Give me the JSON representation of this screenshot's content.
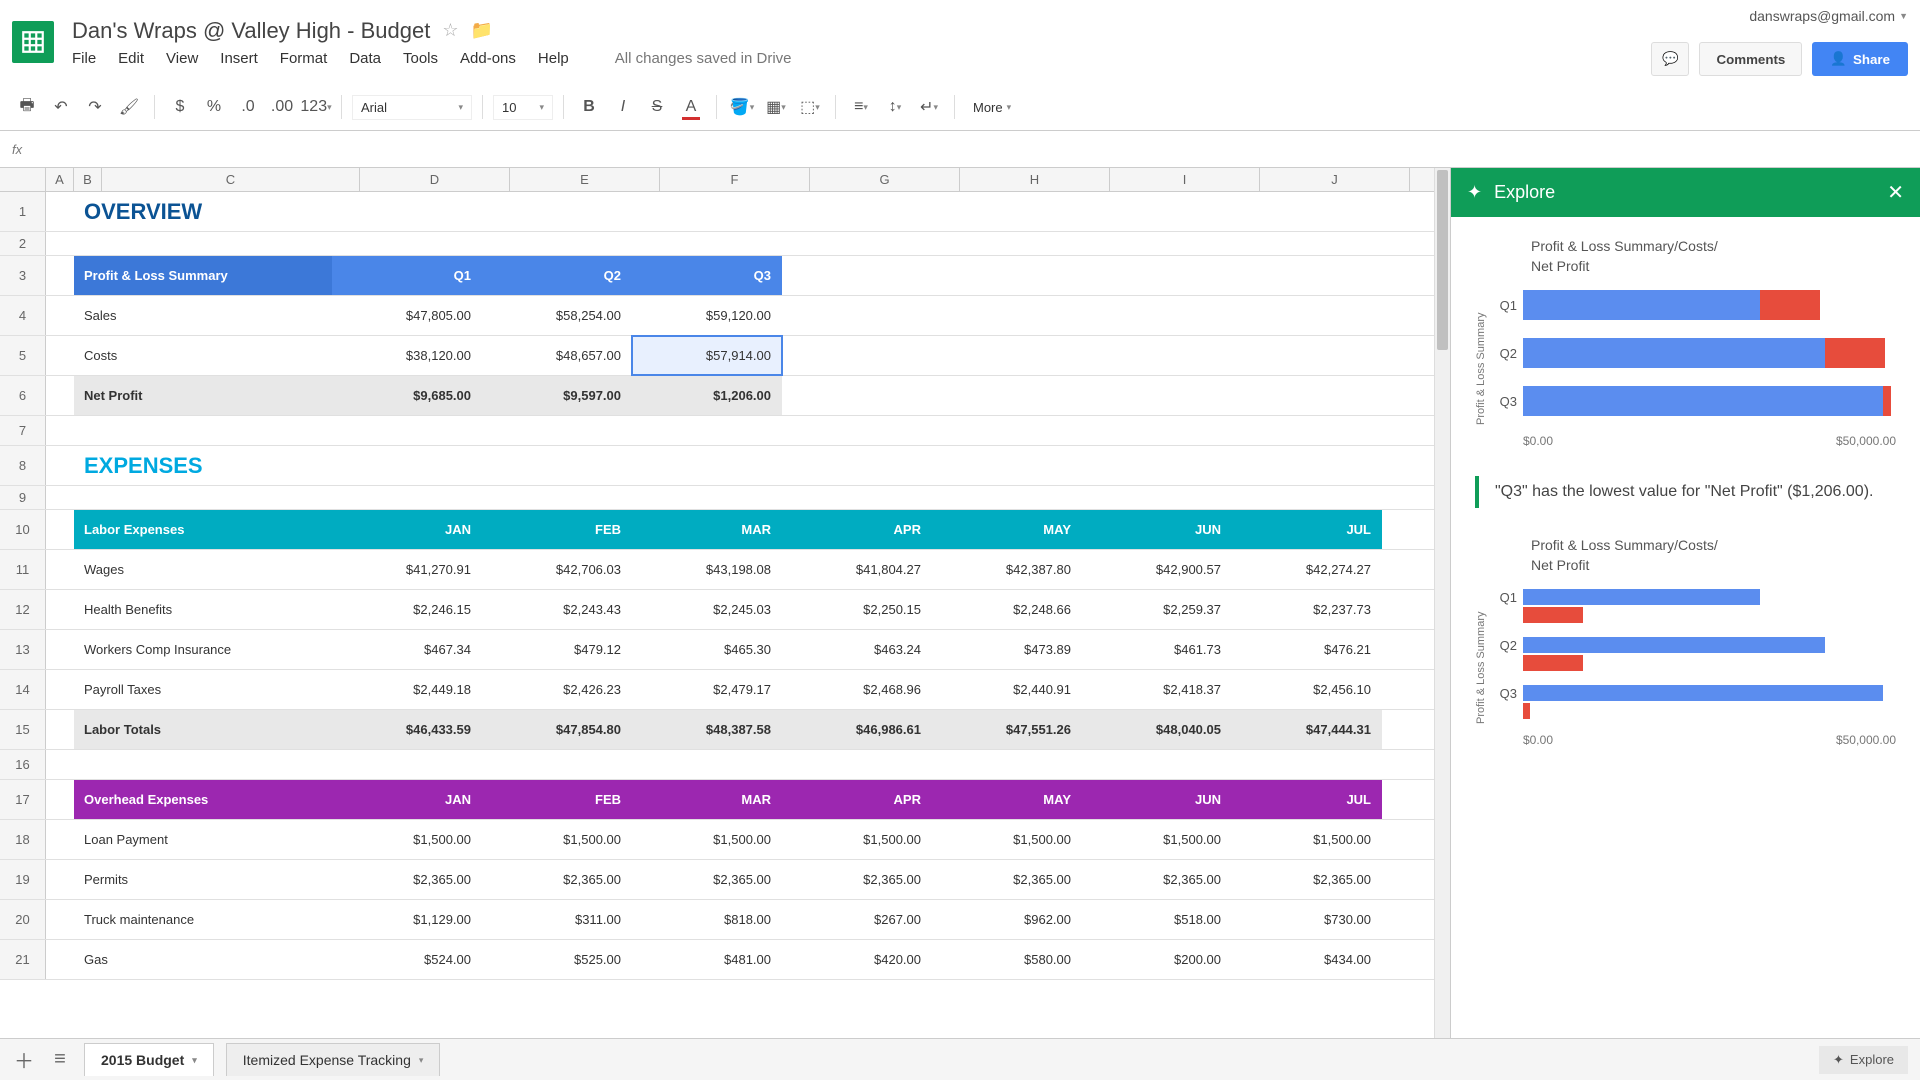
{
  "header": {
    "doc_title": "Dan's Wraps @ Valley High - Budget",
    "user_email": "danswraps@gmail.com",
    "comments_label": "Comments",
    "share_label": "Share",
    "save_status": "All changes saved in Drive"
  },
  "menus": [
    "File",
    "Edit",
    "View",
    "Insert",
    "Format",
    "Data",
    "Tools",
    "Add-ons",
    "Help"
  ],
  "toolbar": {
    "font": "Arial",
    "size": "10",
    "more": "More"
  },
  "columns": [
    "C",
    "D",
    "E",
    "F",
    "G",
    "H",
    "I",
    "J"
  ],
  "sections": {
    "overview": "OVERVIEW",
    "expenses": "EXPENSES"
  },
  "pl_summary": {
    "header": "Profit & Loss Summary",
    "quarters": [
      "Q1",
      "Q2",
      "Q3"
    ],
    "rows": [
      {
        "label": "Sales",
        "values": [
          "$47,805.00",
          "$58,254.00",
          "$59,120.00"
        ]
      },
      {
        "label": "Costs",
        "values": [
          "$38,120.00",
          "$48,657.00",
          "$57,914.00"
        ]
      },
      {
        "label": "Net Profit",
        "values": [
          "$9,685.00",
          "$9,597.00",
          "$1,206.00"
        ],
        "total": true
      }
    ]
  },
  "labor": {
    "header": "Labor Expenses",
    "months": [
      "JAN",
      "FEB",
      "MAR",
      "APR",
      "MAY",
      "JUN",
      "JUL"
    ],
    "rows": [
      {
        "label": "Wages",
        "values": [
          "$41,270.91",
          "$42,706.03",
          "$43,198.08",
          "$41,804.27",
          "$42,387.80",
          "$42,900.57",
          "$42,274.27"
        ]
      },
      {
        "label": "Health Benefits",
        "values": [
          "$2,246.15",
          "$2,243.43",
          "$2,245.03",
          "$2,250.15",
          "$2,248.66",
          "$2,259.37",
          "$2,237.73"
        ]
      },
      {
        "label": "Workers Comp Insurance",
        "values": [
          "$467.34",
          "$479.12",
          "$465.30",
          "$463.24",
          "$473.89",
          "$461.73",
          "$476.21"
        ]
      },
      {
        "label": "Payroll Taxes",
        "values": [
          "$2,449.18",
          "$2,426.23",
          "$2,479.17",
          "$2,468.96",
          "$2,440.91",
          "$2,418.37",
          "$2,456.10"
        ]
      },
      {
        "label": "Labor Totals",
        "values": [
          "$46,433.59",
          "$47,854.80",
          "$48,387.58",
          "$46,986.61",
          "$47,551.26",
          "$48,040.05",
          "$47,444.31"
        ],
        "total": true
      }
    ]
  },
  "overhead": {
    "header": "Overhead Expenses",
    "months": [
      "JAN",
      "FEB",
      "MAR",
      "APR",
      "MAY",
      "JUN",
      "JUL"
    ],
    "rows": [
      {
        "label": "Loan Payment",
        "values": [
          "$1,500.00",
          "$1,500.00",
          "$1,500.00",
          "$1,500.00",
          "$1,500.00",
          "$1,500.00",
          "$1,500.00"
        ]
      },
      {
        "label": "Permits",
        "values": [
          "$2,365.00",
          "$2,365.00",
          "$2,365.00",
          "$2,365.00",
          "$2,365.00",
          "$2,365.00",
          "$2,365.00"
        ]
      },
      {
        "label": "Truck maintenance",
        "values": [
          "$1,129.00",
          "$311.00",
          "$818.00",
          "$267.00",
          "$962.00",
          "$518.00",
          "$730.00"
        ]
      },
      {
        "label": "Gas",
        "values": [
          "$524.00",
          "$525.00",
          "$481.00",
          "$420.00",
          "$580.00",
          "$200.00",
          "$434.00"
        ]
      }
    ]
  },
  "explore": {
    "title": "Explore",
    "chart1_title": "Profit & Loss Summary/Costs/\nNet Profit",
    "chart2_title": "Profit & Loss Summary/Costs/\nNet Profit",
    "yaxis_label": "Profit & Loss Summary",
    "insight": "\"Q3\" has the lowest value for \"Net Profit\" ($1,206.00).",
    "xaxis": [
      "$0.00",
      "$50,000.00"
    ],
    "bottom_label": "Explore"
  },
  "tabs": {
    "sheet1": "2015 Budget",
    "sheet2": "Itemized Expense Tracking"
  },
  "chart_data": [
    {
      "type": "bar",
      "orientation": "horizontal",
      "stacked": true,
      "title": "Profit & Loss Summary/Costs/Net Profit",
      "ylabel": "Profit & Loss Summary",
      "categories": [
        "Q1",
        "Q2",
        "Q3"
      ],
      "series": [
        {
          "name": "Costs",
          "color": "#5b8def",
          "values": [
            38120,
            48657,
            57914
          ]
        },
        {
          "name": "Net Profit",
          "color": "#e74c3c",
          "values": [
            9685,
            9597,
            1206
          ]
        }
      ],
      "xaxis_ticks": [
        0,
        50000
      ],
      "xaxis_tick_labels": [
        "$0.00",
        "$50,000.00"
      ]
    },
    {
      "type": "bar",
      "orientation": "horizontal",
      "grouped": true,
      "title": "Profit & Loss Summary/Costs/Net Profit",
      "ylabel": "Profit & Loss Summary",
      "categories": [
        "Q1",
        "Q2",
        "Q3"
      ],
      "series": [
        {
          "name": "Costs",
          "color": "#5b8def",
          "values": [
            38120,
            48657,
            57914
          ]
        },
        {
          "name": "Net Profit",
          "color": "#e74c3c",
          "values": [
            9685,
            9597,
            1206
          ]
        }
      ],
      "xaxis_ticks": [
        0,
        50000
      ],
      "xaxis_tick_labels": [
        "$0.00",
        "$50,000.00"
      ]
    }
  ]
}
